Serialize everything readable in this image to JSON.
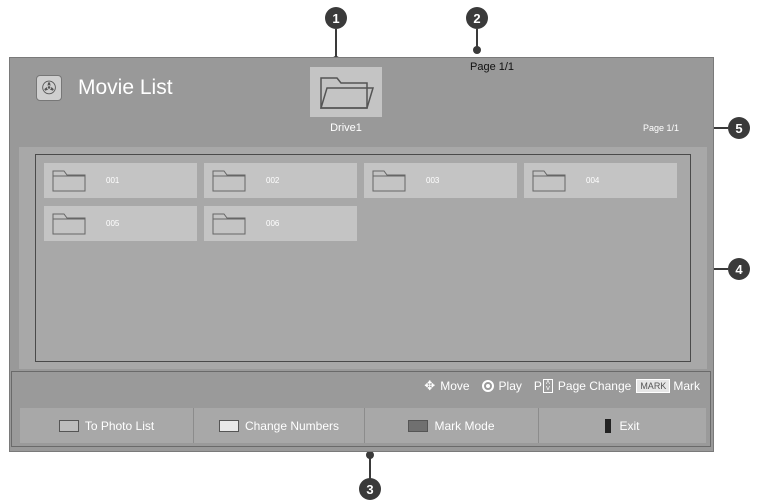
{
  "callouts": [
    "1",
    "2",
    "3",
    "4",
    "5"
  ],
  "header": {
    "title": "Movie List",
    "drive_label": "Drive1",
    "page_top": "Page 1/1",
    "page_right": "Page 1/1"
  },
  "folders": [
    "001",
    "002",
    "003",
    "004",
    "005",
    "006"
  ],
  "legend": {
    "move": "Move",
    "play": "Play",
    "p": "P",
    "page_change": "Page Change",
    "mark_key": "MARK",
    "mark": "Mark"
  },
  "buttons": [
    {
      "label": "To Photo List",
      "color": "#bdbdbd"
    },
    {
      "label": "Change Numbers",
      "color": "#e8e8e8"
    },
    {
      "label": "Mark Mode",
      "color": "#707070"
    },
    {
      "label": "Exit",
      "color": "#222222"
    }
  ]
}
